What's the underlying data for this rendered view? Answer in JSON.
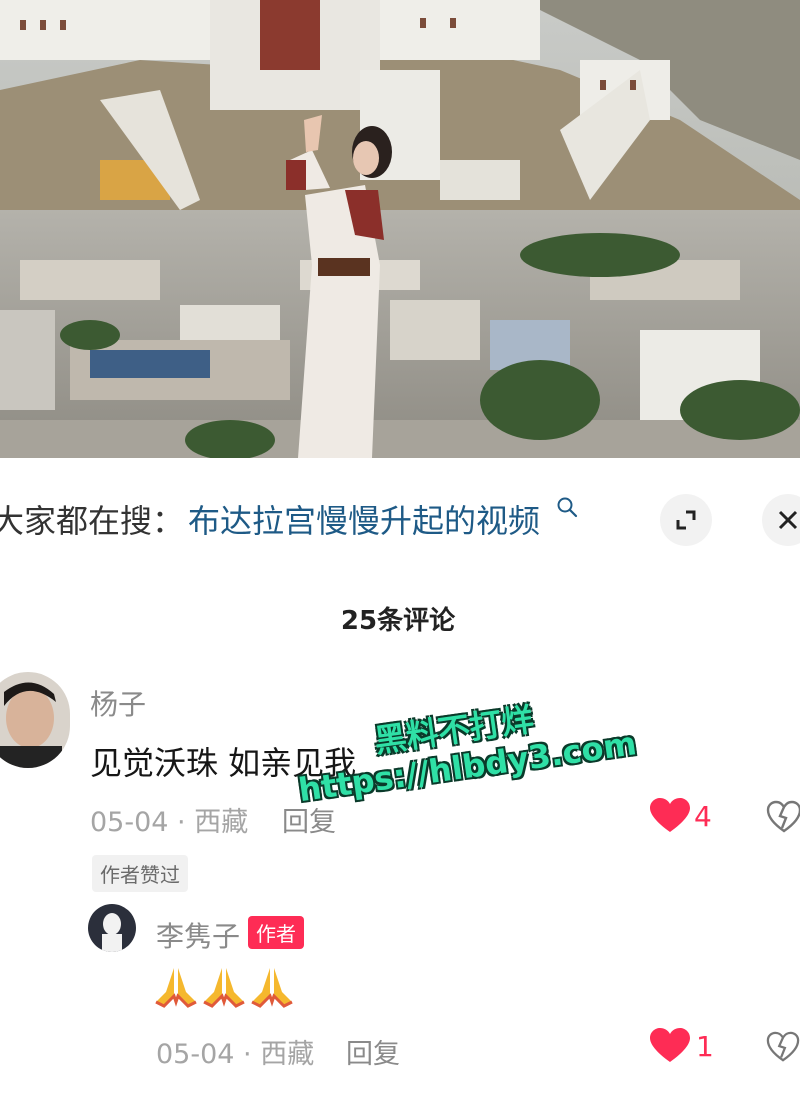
{
  "search_bar": {
    "prefix": "大家都在搜：",
    "query": "布达拉宫慢慢升起的视频"
  },
  "comments": {
    "title": "25条评论",
    "main": {
      "username": "杨子",
      "text": "见觉沃珠 如亲见我",
      "meta": "05-04 · 西藏",
      "reply_label": "回复",
      "like_count": "4",
      "liked_by_author": "作者赞过"
    },
    "reply": {
      "username": "李隽子",
      "badge": "作者",
      "text": "🙏🙏🙏",
      "meta": "05-04 · 西藏",
      "reply_label": "回复",
      "like_count": "1"
    }
  },
  "watermark": {
    "line1": "黑料不打烊",
    "line2": "https://hlbdy3.com"
  },
  "colors": {
    "like_red": "#fe2c55",
    "query_blue": "#1e5a86",
    "watermark_green": "#2fe0a6"
  },
  "icons": [
    "search-icon",
    "expand-icon",
    "close-icon",
    "heart-filled-icon",
    "heart-outline-icon",
    "pray-emoji"
  ]
}
